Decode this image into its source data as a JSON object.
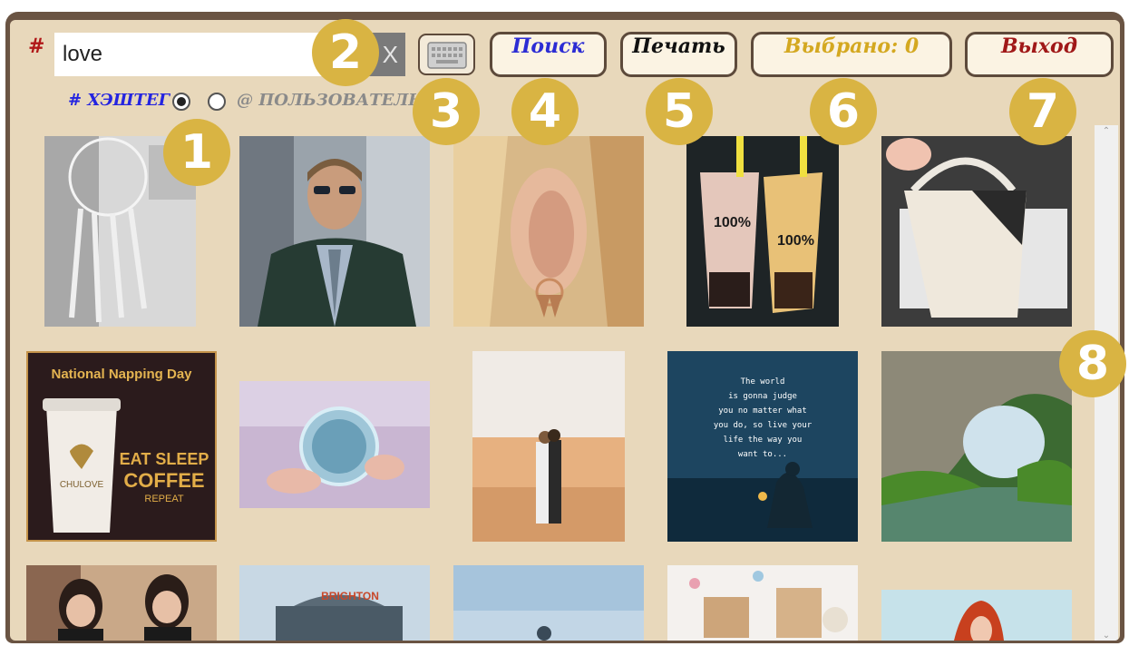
{
  "search": {
    "hash_symbol": "#",
    "value": "love",
    "clear": "X"
  },
  "toolbar": {
    "search_label": "Поиск",
    "print_label": "Печать",
    "selected_label": "Выбрано: 0",
    "exit_label": "Выход"
  },
  "mode": {
    "hashtag_label": "# ХЭШТЕГ",
    "user_label": "@ ПОЛЬЗОВАТЕЛЬ",
    "selected": "hashtag"
  },
  "callouts": [
    "1",
    "2",
    "3",
    "4",
    "5",
    "6",
    "7",
    "8"
  ],
  "photos": {
    "napping_title": "National Napping Day",
    "cup_brand": "CHULOVE",
    "coffee_slogan": [
      "EAT SLEEP",
      "COFFEE",
      "REPEAT"
    ],
    "cup_text": "100%",
    "quote": [
      "The world",
      "is gonna judge",
      "you no matter what",
      "you do, so live your",
      "life the way you",
      "want to..."
    ],
    "pier_sign": "BRIGHTON"
  },
  "colors": {
    "panel_bg": "#e8d8bb",
    "frame": "#6a5443",
    "badge": "#d9b443",
    "search_text": "#2c2cd4",
    "selected_text": "#d4a820",
    "exit_text": "#a01818",
    "hash_mark": "#b01818",
    "hashtag_label": "#2424e0"
  },
  "icons": [
    "keyboard-icon",
    "close-icon",
    "chevron-up-icon",
    "chevron-down-icon"
  ]
}
